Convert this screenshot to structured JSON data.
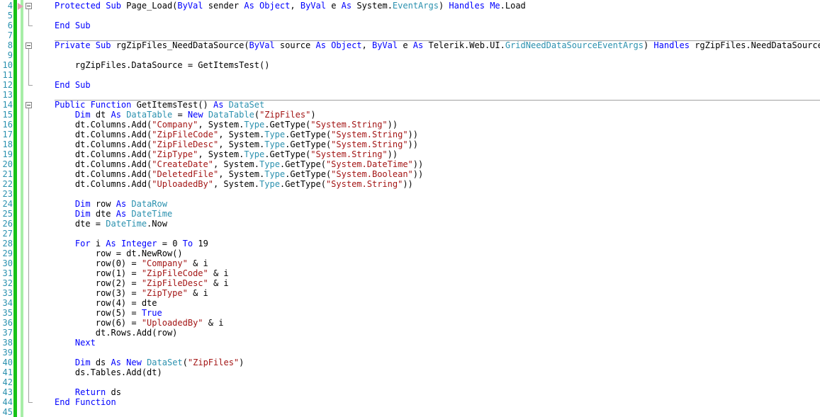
{
  "editor": {
    "lines": [
      {
        "n": "4",
        "segs": [
          [
            "kw",
            "Protected Sub "
          ],
          [
            "",
            "Page_Load("
          ],
          [
            "kw",
            "ByVal "
          ],
          [
            "",
            "sender "
          ],
          [
            "kw",
            "As "
          ],
          [
            "kw",
            "Object"
          ],
          [
            "",
            ", "
          ],
          [
            "kw",
            "ByVal "
          ],
          [
            "",
            "e "
          ],
          [
            "kw",
            "As "
          ],
          [
            "",
            "System."
          ],
          [
            "ty",
            "EventArgs"
          ],
          [
            "",
            ") "
          ],
          [
            "kw",
            "Handles Me"
          ],
          [
            "",
            ".Load"
          ]
        ]
      },
      {
        "n": "5",
        "segs": []
      },
      {
        "n": "6",
        "segs": [
          [
            "kw",
            "End Sub"
          ]
        ]
      },
      {
        "n": "7",
        "segs": []
      },
      {
        "n": "8",
        "segs": [
          [
            "kw",
            "Private Sub "
          ],
          [
            "",
            "rgZipFiles_NeedDataSource("
          ],
          [
            "kw",
            "ByVal "
          ],
          [
            "",
            "source "
          ],
          [
            "kw",
            "As "
          ],
          [
            "kw",
            "Object"
          ],
          [
            "",
            ", "
          ],
          [
            "kw",
            "ByVal "
          ],
          [
            "",
            "e "
          ],
          [
            "kw",
            "As "
          ],
          [
            "",
            "Telerik.Web.UI."
          ],
          [
            "ty",
            "GridNeedDataSourceEventArgs"
          ],
          [
            "",
            ") "
          ],
          [
            "kw",
            "Handles "
          ],
          [
            "",
            "rgZipFiles.NeedDataSource"
          ]
        ]
      },
      {
        "n": "9",
        "segs": []
      },
      {
        "n": "10",
        "segs": [
          [
            "",
            "    rgZipFiles.DataSource = GetItemsTest()"
          ]
        ]
      },
      {
        "n": "11",
        "segs": []
      },
      {
        "n": "12",
        "segs": [
          [
            "kw",
            "End Sub"
          ]
        ]
      },
      {
        "n": "13",
        "segs": []
      },
      {
        "n": "14",
        "segs": [
          [
            "kw",
            "Public Function "
          ],
          [
            "",
            "GetItemsTest() "
          ],
          [
            "kw",
            "As "
          ],
          [
            "ty",
            "DataSet"
          ]
        ]
      },
      {
        "n": "15",
        "segs": [
          [
            "",
            "    "
          ],
          [
            "kw",
            "Dim "
          ],
          [
            "",
            "dt "
          ],
          [
            "kw",
            "As "
          ],
          [
            "ty",
            "DataTable"
          ],
          [
            "",
            " = "
          ],
          [
            "kw",
            "New "
          ],
          [
            "ty",
            "DataTable"
          ],
          [
            "",
            "("
          ],
          [
            "st",
            "\"ZipFiles\""
          ],
          [
            "",
            ")"
          ]
        ]
      },
      {
        "n": "16",
        "segs": [
          [
            "",
            "    dt.Columns.Add("
          ],
          [
            "st",
            "\"Company\""
          ],
          [
            "",
            ", System."
          ],
          [
            "ty",
            "Type"
          ],
          [
            "",
            ".GetType("
          ],
          [
            "st",
            "\"System.String\""
          ],
          [
            "",
            "))"
          ]
        ]
      },
      {
        "n": "17",
        "segs": [
          [
            "",
            "    dt.Columns.Add("
          ],
          [
            "st",
            "\"ZipFileCode\""
          ],
          [
            "",
            ", System."
          ],
          [
            "ty",
            "Type"
          ],
          [
            "",
            ".GetType("
          ],
          [
            "st",
            "\"System.String\""
          ],
          [
            "",
            "))"
          ]
        ]
      },
      {
        "n": "18",
        "segs": [
          [
            "",
            "    dt.Columns.Add("
          ],
          [
            "st",
            "\"ZipFileDesc\""
          ],
          [
            "",
            ", System."
          ],
          [
            "ty",
            "Type"
          ],
          [
            "",
            ".GetType("
          ],
          [
            "st",
            "\"System.String\""
          ],
          [
            "",
            "))"
          ]
        ]
      },
      {
        "n": "19",
        "segs": [
          [
            "",
            "    dt.Columns.Add("
          ],
          [
            "st",
            "\"ZipType\""
          ],
          [
            "",
            ", System."
          ],
          [
            "ty",
            "Type"
          ],
          [
            "",
            ".GetType("
          ],
          [
            "st",
            "\"System.String\""
          ],
          [
            "",
            "))"
          ]
        ]
      },
      {
        "n": "20",
        "segs": [
          [
            "",
            "    dt.Columns.Add("
          ],
          [
            "st",
            "\"CreateDate\""
          ],
          [
            "",
            ", System."
          ],
          [
            "ty",
            "Type"
          ],
          [
            "",
            ".GetType("
          ],
          [
            "st",
            "\"System.DateTime\""
          ],
          [
            "",
            "))"
          ]
        ]
      },
      {
        "n": "21",
        "segs": [
          [
            "",
            "    dt.Columns.Add("
          ],
          [
            "st",
            "\"DeletedFile\""
          ],
          [
            "",
            ", System."
          ],
          [
            "ty",
            "Type"
          ],
          [
            "",
            ".GetType("
          ],
          [
            "st",
            "\"System.Boolean\""
          ],
          [
            "",
            "))"
          ]
        ]
      },
      {
        "n": "22",
        "segs": [
          [
            "",
            "    dt.Columns.Add("
          ],
          [
            "st",
            "\"UploadedBy\""
          ],
          [
            "",
            ", System."
          ],
          [
            "ty",
            "Type"
          ],
          [
            "",
            ".GetType("
          ],
          [
            "st",
            "\"System.String\""
          ],
          [
            "",
            "))"
          ]
        ]
      },
      {
        "n": "23",
        "segs": []
      },
      {
        "n": "24",
        "segs": [
          [
            "",
            "    "
          ],
          [
            "kw",
            "Dim "
          ],
          [
            "",
            "row "
          ],
          [
            "kw",
            "As "
          ],
          [
            "ty",
            "DataRow"
          ]
        ]
      },
      {
        "n": "25",
        "segs": [
          [
            "",
            "    "
          ],
          [
            "kw",
            "Dim "
          ],
          [
            "",
            "dte "
          ],
          [
            "kw",
            "As "
          ],
          [
            "ty",
            "DateTime"
          ]
        ]
      },
      {
        "n": "26",
        "segs": [
          [
            "",
            "    dte = "
          ],
          [
            "ty",
            "DateTime"
          ],
          [
            "",
            ".Now"
          ]
        ]
      },
      {
        "n": "27",
        "segs": []
      },
      {
        "n": "28",
        "segs": [
          [
            "",
            "    "
          ],
          [
            "kw",
            "For "
          ],
          [
            "",
            "i "
          ],
          [
            "kw",
            "As Integer "
          ],
          [
            "",
            "= 0 "
          ],
          [
            "kw",
            "To "
          ],
          [
            "",
            "19"
          ]
        ]
      },
      {
        "n": "29",
        "segs": [
          [
            "",
            "        row = dt.NewRow()"
          ]
        ]
      },
      {
        "n": "30",
        "segs": [
          [
            "",
            "        row(0) = "
          ],
          [
            "st",
            "\"Company\""
          ],
          [
            "",
            " & i"
          ]
        ]
      },
      {
        "n": "31",
        "segs": [
          [
            "",
            "        row(1) = "
          ],
          [
            "st",
            "\"ZipFileCode\""
          ],
          [
            "",
            " & i"
          ]
        ]
      },
      {
        "n": "32",
        "segs": [
          [
            "",
            "        row(2) = "
          ],
          [
            "st",
            "\"ZipFileDesc\""
          ],
          [
            "",
            " & i"
          ]
        ]
      },
      {
        "n": "33",
        "segs": [
          [
            "",
            "        row(3) = "
          ],
          [
            "st",
            "\"ZipType\""
          ],
          [
            "",
            " & i"
          ]
        ]
      },
      {
        "n": "34",
        "segs": [
          [
            "",
            "        row(4) = dte"
          ]
        ]
      },
      {
        "n": "35",
        "segs": [
          [
            "",
            "        row(5) = "
          ],
          [
            "kw",
            "True"
          ]
        ]
      },
      {
        "n": "36",
        "segs": [
          [
            "",
            "        row(6) = "
          ],
          [
            "st",
            "\"UploadedBy\""
          ],
          [
            "",
            " & i"
          ]
        ]
      },
      {
        "n": "37",
        "segs": [
          [
            "",
            "        dt.Rows.Add(row)"
          ]
        ]
      },
      {
        "n": "38",
        "segs": [
          [
            "",
            "    "
          ],
          [
            "kw",
            "Next"
          ]
        ]
      },
      {
        "n": "39",
        "segs": []
      },
      {
        "n": "40",
        "segs": [
          [
            "",
            "    "
          ],
          [
            "kw",
            "Dim "
          ],
          [
            "",
            "ds "
          ],
          [
            "kw",
            "As New "
          ],
          [
            "ty",
            "DataSet"
          ],
          [
            "",
            "("
          ],
          [
            "st",
            "\"ZipFiles\""
          ],
          [
            "",
            ")"
          ]
        ]
      },
      {
        "n": "41",
        "segs": [
          [
            "",
            "    ds.Tables.Add(dt)"
          ]
        ]
      },
      {
        "n": "42",
        "segs": []
      },
      {
        "n": "43",
        "segs": [
          [
            "",
            "    "
          ],
          [
            "kw",
            "Return "
          ],
          [
            "",
            "ds"
          ]
        ]
      },
      {
        "n": "44",
        "segs": [
          [
            "kw",
            "End Function"
          ]
        ]
      },
      {
        "n": "45",
        "segs": []
      }
    ]
  },
  "colors": {
    "keyword": "#0000ff",
    "type": "#2b91af",
    "string": "#a31515",
    "line_number": "#2b91af",
    "change_bar_saved": "#17c217",
    "change_bar_light": "#a7eea7"
  },
  "icons": {
    "current_statement": "breakpoint-arrow-icon",
    "collapse": "collapse-minus-icon"
  }
}
